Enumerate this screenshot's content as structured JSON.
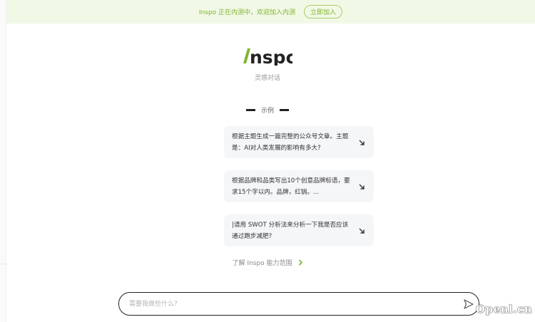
{
  "banner": {
    "text": "Inspo 正在内测中，欢迎加入内测",
    "button_label": "立即加入",
    "accent_color": "#7cb62c",
    "background_color": "#f2f8e6"
  },
  "logo": {
    "text": "Inspo",
    "accent_color": "#7cb62c"
  },
  "subtitle": "灵感对话",
  "examples": {
    "label": "示例",
    "items": [
      {
        "text": "根据主题生成一篇完整的公众号文章。主题是：AI对人类发展的影响有多大?",
        "icon": "arrow-down-right-icon"
      },
      {
        "text": "根据品牌和品类写出10个创意品牌标语，要求15个字以内。品牌，红锅。...",
        "icon": "arrow-down-right-icon"
      },
      {
        "text": "|请用 SWOT 分析法来分析一下我是否应该通过跑步减肥?",
        "icon": "arrow-down-right-icon"
      }
    ]
  },
  "learn_more": {
    "label": "了解 Inspo 能力范围",
    "icon": "chevron-right-icon"
  },
  "composer": {
    "placeholder": "需要我做些什么?",
    "value": "",
    "send_icon": "send-icon"
  },
  "watermark": "Openl.cn"
}
